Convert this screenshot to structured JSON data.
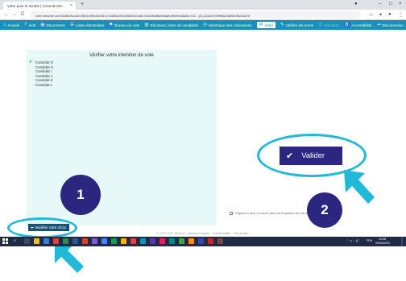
{
  "browser": {
    "tab_title": "Voter pour le scrutin | Consult Inte...",
    "tab_close": "×",
    "new_tab": "+",
    "url": "vote.neovote.com/2c6b1f1c42e1f6d1e3f3cbb1f41c7a4d6c2901df8c5c1bc8c7a91f35d6d0f4a8b2f0d9e33a8c7e12...(0),22a41b78f96302a55fc3bc0a37d",
    "nav": {
      "back": "←",
      "forward": "→",
      "reload": "C"
    }
  },
  "navbar": {
    "items": [
      {
        "icon": "⌂",
        "label": "Accueil"
      },
      {
        "icon": "?",
        "label": "Aide"
      },
      {
        "icon": "▤",
        "label": "Documents"
      },
      {
        "icon": "☰",
        "label": "Listes électorales"
      },
      {
        "icon": "⚑",
        "label": "Bureau de vote"
      },
      {
        "icon": "▥",
        "label": "Electeurs, listes de candidats"
      },
      {
        "icon": "◷",
        "label": "Historique des connexions"
      },
      {
        "icon": "✉",
        "label": "Voter"
      },
      {
        "icon": "✎",
        "label": "Vérifier les urnes"
      },
      {
        "icon": "⚖",
        "label": "Résultats"
      },
      {
        "icon": "♿",
        "label": "Accessibilité"
      },
      {
        "icon": "⇥",
        "label": "Déconnexion"
      }
    ]
  },
  "panel": {
    "title": "Vérifier votre intention de vote",
    "candidates": [
      "Candidat G",
      "Candidat H",
      "Candidat I",
      "Candidat J",
      "Candidat K",
      "Candidat L"
    ]
  },
  "buttons": {
    "valider": "Valider",
    "modifier": "Modifier votre choix"
  },
  "disclaimer": "Cliquez ici pour en savoir plus sur la gestion de vos données personnelles",
  "footer": "© 2007-2021 Neovote · Mentions légales · Confidentialité · Plan du site",
  "annotations": {
    "step1": "1",
    "step2": "2"
  },
  "taskbar": {
    "lang": "FRA",
    "time": "14:48",
    "date": "29/04/2021"
  },
  "colors": {
    "navbar": "#1a8fb8",
    "panel": "#e6f8f7",
    "valider": "#2b2680",
    "modifier": "#1a5276",
    "annotation_ring": "#22b8d8",
    "annotation_badge": "#2b2680"
  }
}
